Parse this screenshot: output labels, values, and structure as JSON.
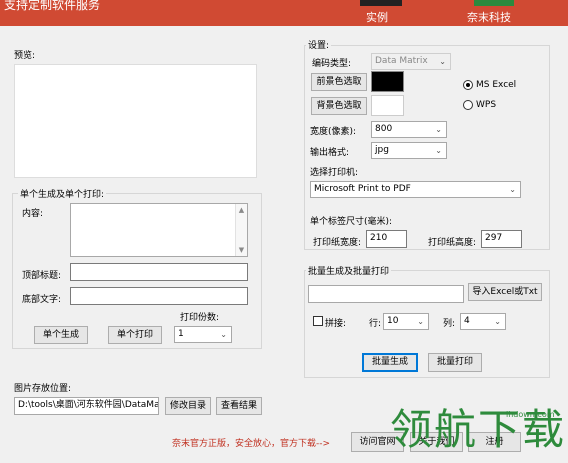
{
  "banner": {
    "title": "支持定制软件服务",
    "nav_example": "实例",
    "nav_company": "奈末科技"
  },
  "preview": {
    "label": "预览:"
  },
  "settings": {
    "group_title": "设置:",
    "code_type_label": "编码类型:",
    "code_type_value": "Data Matrix",
    "fg_button": "前景色选取",
    "bg_button": "背景色选取",
    "fg_color": "#000000",
    "bg_color": "#ffffff",
    "radio_ms": "MS  Excel",
    "radio_wps": "WPS",
    "width_label": "宽度(像素):",
    "width_value": "800",
    "format_label": "输出格式:",
    "format_value": "jpg",
    "printer_label": "选择打印机:",
    "printer_value": "Microsoft Print to PDF",
    "label_size_label": "单个标签尺寸(毫米):",
    "paper_width_label": "打印纸宽度:",
    "paper_width_value": "210",
    "paper_height_label": "打印纸高度:",
    "paper_height_value": "297"
  },
  "single": {
    "group_title": "单个生成及单个打印:",
    "content_label": "内容:",
    "top_title_label": "顶部标题:",
    "bottom_text_label": "底部文字:",
    "copies_label": "打印份数:",
    "copies_value": "1",
    "gen_button": "单个生成",
    "print_button": "单个打印"
  },
  "batch": {
    "group_title": "批量生成及批量打印",
    "import_button": "导入Excel或Txt",
    "splice_label": "拼接:",
    "row_label": "行:",
    "row_value": "10",
    "col_label": "列:",
    "col_value": "4",
    "gen_button": "批量生成",
    "print_button": "批量打印"
  },
  "storage": {
    "label": "图片存放位置:",
    "path": "D:\\tools\\桌面\\河东软件园\\DataMa",
    "modify_button": "修改目录",
    "view_button": "查看结果"
  },
  "footer": {
    "note": "奈末官方正版，安全放心，官方下载-->",
    "visit_button": "访问官网",
    "about_button": "关于我们",
    "register_button": "注册"
  },
  "watermark": {
    "text": "领航下载",
    "url": "lhdown.com"
  }
}
